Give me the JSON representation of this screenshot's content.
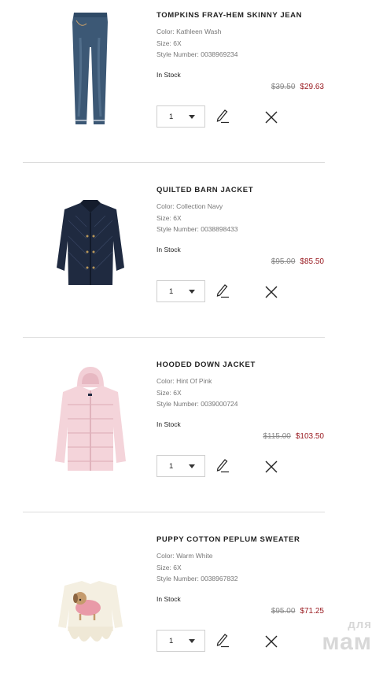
{
  "cart": {
    "items": [
      {
        "name": "TOMPKINS FRAY-HEM SKINNY JEAN",
        "color_label": "Color:",
        "color": "Kathleen Wash",
        "size_label": "Size:",
        "size": "6X",
        "style_label": "Style Number:",
        "style": "0038969234",
        "stock": "In Stock",
        "price_original": "$39.50",
        "price_sale": "$29.63",
        "qty": "1",
        "image_icon": "jeans-icon"
      },
      {
        "name": "QUILTED BARN JACKET",
        "color_label": "Color:",
        "color": "Collection Navy",
        "size_label": "Size:",
        "size": "6X",
        "style_label": "Style Number:",
        "style": "0038898433",
        "stock": "In Stock",
        "price_original": "$95.00",
        "price_sale": "$85.50",
        "qty": "1",
        "image_icon": "quilted-jacket-icon"
      },
      {
        "name": "HOODED DOWN JACKET",
        "color_label": "Color:",
        "color": "Hint Of Pink",
        "size_label": "Size:",
        "size": "6X",
        "style_label": "Style Number:",
        "style": "0039000724",
        "stock": "In Stock",
        "price_original": "$115.00",
        "price_sale": "$103.50",
        "qty": "1",
        "image_icon": "down-jacket-icon"
      },
      {
        "name": "PUPPY COTTON PEPLUM SWEATER",
        "color_label": "Color:",
        "color": "Warm White",
        "size_label": "Size:",
        "size": "6X",
        "style_label": "Style Number:",
        "style": "0038967832",
        "stock": "In Stock",
        "price_original": "$95.00",
        "price_sale": "$71.25",
        "qty": "1",
        "image_icon": "puppy-sweater-icon"
      }
    ]
  },
  "watermark": {
    "line1": "для",
    "line2": "мам"
  },
  "colors": {
    "sale_price": "#9a1c22",
    "divider": "#dcdcdc",
    "meta_text": "#777777"
  }
}
